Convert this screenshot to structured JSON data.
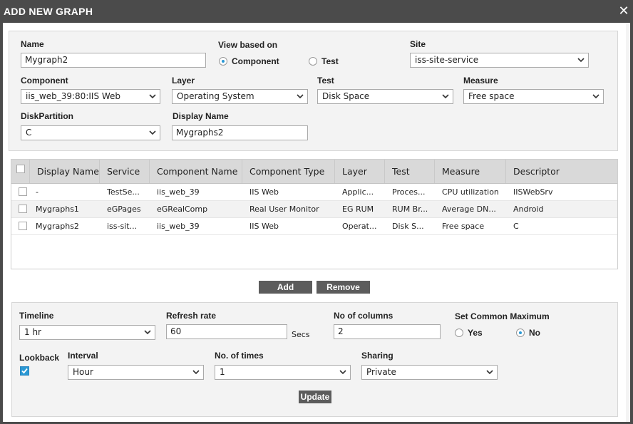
{
  "dialog": {
    "title": "ADD NEW GRAPH",
    "close_label": "✕"
  },
  "form": {
    "name_label": "Name",
    "name_value": "Mygraph2",
    "view_based_on_label": "View based on",
    "view_options": [
      {
        "label": "Component",
        "selected": true
      },
      {
        "label": "Test",
        "selected": false
      }
    ],
    "site_label": "Site",
    "site_value": "iss-site-service",
    "component_label": "Component",
    "component_value": "iis_web_39:80:IIS Web",
    "layer_label": "Layer",
    "layer_value": "Operating System",
    "test_label": "Test",
    "test_value": "Disk Space",
    "measure_label": "Measure",
    "measure_value": "Free space",
    "diskpartition_label": "DiskPartition",
    "diskpartition_value": "C",
    "display_name_label": "Display Name",
    "display_name_value": "Mygraphs2"
  },
  "table": {
    "headers": [
      "Display Name",
      "Service",
      "Component Name",
      "Component Type",
      "Layer",
      "Test",
      "Measure",
      "Descriptor"
    ],
    "rows": [
      [
        "-",
        "TestSe...",
        "iis_web_39",
        "IIS Web",
        "Applic...",
        "Proces...",
        "CPU utilization",
        "IISWebSrv"
      ],
      [
        "Mygraphs1",
        "eGPages",
        "eGRealComp",
        "Real User Monitor",
        "EG RUM",
        "RUM Br...",
        "Average DN...",
        "Android"
      ],
      [
        "Mygraphs2",
        "iss-sit...",
        "iis_web_39",
        "IIS Web",
        "Operat...",
        "Disk S...",
        "Free space",
        "C"
      ]
    ]
  },
  "actions": {
    "add_label": "Add",
    "remove_label": "Remove"
  },
  "settings": {
    "timeline_label": "Timeline",
    "timeline_value": "1 hr",
    "refresh_label": "Refresh rate",
    "refresh_value": "60",
    "refresh_unit": "Secs",
    "columns_label": "No of columns",
    "columns_value": "2",
    "common_max_label": "Set Common Maximum",
    "common_max_options": [
      {
        "label": "Yes",
        "selected": false
      },
      {
        "label": "No",
        "selected": true
      }
    ],
    "lookback_label": "Lookback",
    "lookback_checked": true,
    "interval_label": "Interval",
    "interval_value": "Hour",
    "times_label": "No. of times",
    "times_value": "1",
    "sharing_label": "Sharing",
    "sharing_value": "Private",
    "update_label": "Update"
  },
  "colors": {
    "accent": "#2a98d4",
    "titlebar": "#4b4b4b",
    "button": "#5c5c5c",
    "panel": "#f3f3f3",
    "grid_header": "#d9d9d9"
  }
}
